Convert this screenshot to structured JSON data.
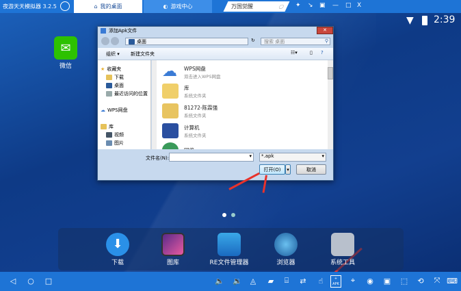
{
  "titlebar": {
    "app_title": "夜游天天模拟器 3.2.5",
    "tabs": [
      {
        "label": "我的桌面",
        "active": true
      },
      {
        "label": "游戏中心",
        "active": false
      }
    ],
    "search_value": "万国觉醒",
    "window_controls": [
      "pin",
      "shrink",
      "settings",
      "minimize",
      "maximize",
      "close"
    ]
  },
  "status": {
    "time": "2:39"
  },
  "desktop": {
    "apps": [
      {
        "label": "微信"
      }
    ],
    "dock": [
      {
        "label": "下载"
      },
      {
        "label": "图库"
      },
      {
        "label": "RE文件管理器"
      },
      {
        "label": "浏览器"
      },
      {
        "label": "系统工具"
      }
    ]
  },
  "dialog": {
    "title": "添加Apk文件",
    "address": "桌面",
    "search_placeholder": "搜索 桌面",
    "toolbar": {
      "organize": "组织 ▾",
      "new_folder": "新建文件夹"
    },
    "sidebar": [
      {
        "label": "收藏夹"
      },
      {
        "label": "下载"
      },
      {
        "label": "桌面"
      },
      {
        "label": "最近访问的位置"
      },
      {
        "label": "WPS网盘"
      },
      {
        "label": "库"
      },
      {
        "label": "视频"
      },
      {
        "label": "图片"
      }
    ],
    "files": [
      {
        "name": "WPS网盘",
        "desc": "双击进入WPS网盘"
      },
      {
        "name": "库",
        "desc": "系统文件夹"
      },
      {
        "name": "81272-陈霖强",
        "desc": "系统文件夹"
      },
      {
        "name": "计算机",
        "desc": "系统文件夹"
      },
      {
        "name": "网络",
        "desc": ""
      }
    ],
    "filename_label": "文件名(N):",
    "filename_value": "",
    "filetype": "*.apk",
    "open_button": "打开(O)",
    "cancel_button": "取消"
  },
  "bottombar": {
    "apk_label": "APK"
  }
}
